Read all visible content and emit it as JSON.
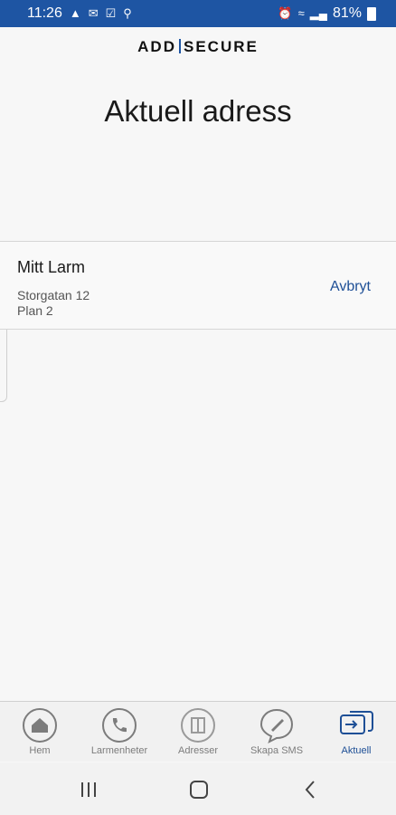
{
  "status_bar": {
    "time": "11:26",
    "battery": "81%"
  },
  "app": {
    "logo_left": "ADD",
    "logo_right": "SECURE",
    "title": "Aktuell adress"
  },
  "address": {
    "name": "Mitt Larm",
    "street": "Storgatan 12",
    "floor": "Plan 2",
    "cancel_label": "Avbryt"
  },
  "tabs": [
    {
      "label": "Hem",
      "icon": "home-icon"
    },
    {
      "label": "Larmenheter",
      "icon": "phone-icon"
    },
    {
      "label": "Adresser",
      "icon": "address-book-icon"
    },
    {
      "label": "Skapa SMS",
      "icon": "compose-sms-icon"
    },
    {
      "label": "Aktuell",
      "icon": "current-address-icon",
      "active": true
    }
  ],
  "colors": {
    "accent": "#1e55a3",
    "link": "#1e4f96",
    "inactive": "#7c7c7c"
  }
}
